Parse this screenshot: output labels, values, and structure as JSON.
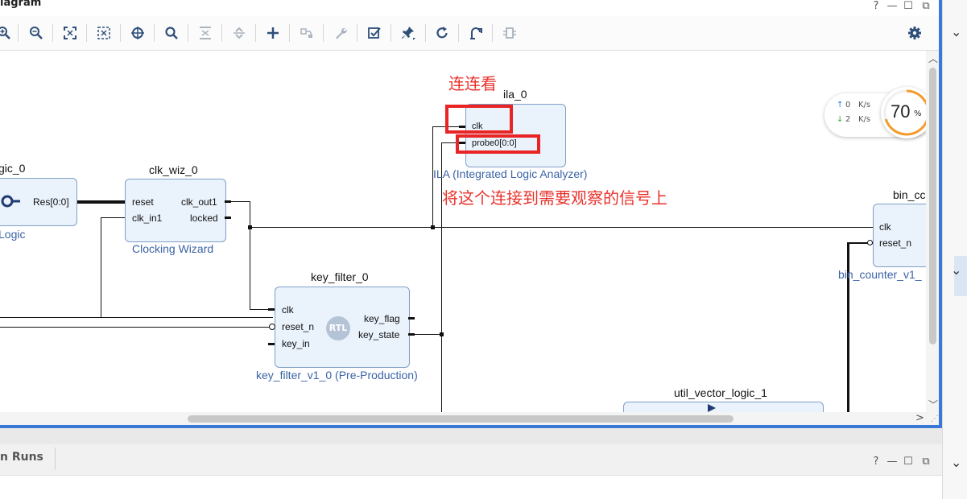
{
  "window": {
    "title": "iagram",
    "help_label": "?",
    "minimize_label": "—",
    "maximize_label": "☐",
    "restore_label": "⧉",
    "close_label": "✕"
  },
  "toolbar": {
    "tools": [
      "zoom-in-icon",
      "zoom-out-icon",
      "zoom-fit-icon",
      "zoom-area-icon",
      "crosshair-icon",
      "search-icon",
      "collapse-icon",
      "expand-icon",
      "add-ip-icon",
      "connect-icon",
      "wrench-icon",
      "validate-icon",
      "pin-icon",
      "regenerate-icon",
      "optimize-routing-icon",
      "port-icon",
      "settings-gear-icon"
    ]
  },
  "diagram": {
    "blocks": {
      "util_logic_0": {
        "title": "gic_0",
        "port_out": "Res[0:0]",
        "subtitle": "Logic"
      },
      "clk_wiz_0": {
        "title": "clk_wiz_0",
        "ports_in": [
          "reset",
          "clk_in1"
        ],
        "ports_out": [
          "clk_out1",
          "locked"
        ],
        "subtitle": "Clocking Wizard"
      },
      "ila_0": {
        "title": "ila_0",
        "ports_in": [
          "clk",
          "probe0[0:0]"
        ],
        "subtitle": "ILA (Integrated Logic Analyzer)"
      },
      "key_filter_0": {
        "title": "key_filter_0",
        "ports_in": [
          "clk",
          "reset_n",
          "key_in"
        ],
        "ports_out": [
          "key_flag",
          "key_state"
        ],
        "badge": "RTL",
        "subtitle": "key_filter_v1_0 (Pre-Production)"
      },
      "bin_counter": {
        "title": "bin_cc",
        "ports_in": [
          "clk",
          "reset_n"
        ],
        "subtitle": "bin_counter_v1_"
      },
      "util_vector_logic_1": {
        "title": "util_vector_logic_1"
      }
    },
    "annotations": {
      "top": "连连看",
      "instruction": "将这个连接到需要观察的信号上"
    },
    "colors": {
      "annotation": "#e8322c",
      "block_fill": "#eaf2fc",
      "subtitle": "#3b63a6",
      "frame": "#3b79d6"
    }
  },
  "speed_widget": {
    "up": "0",
    "down": "2",
    "unit": "K/s",
    "percent": "70",
    "percent_sign": "%",
    "up_arrow": "↑",
    "down_arrow": "↓"
  },
  "bottom_panel": {
    "tab_label": "n Runs",
    "help_label": "?",
    "minimize_label": "—",
    "maximize_label": "☐",
    "restore_label": "⧉"
  },
  "right_strip": {
    "chevrons": [
      "⌄",
      "⌄",
      "⌄"
    ]
  }
}
